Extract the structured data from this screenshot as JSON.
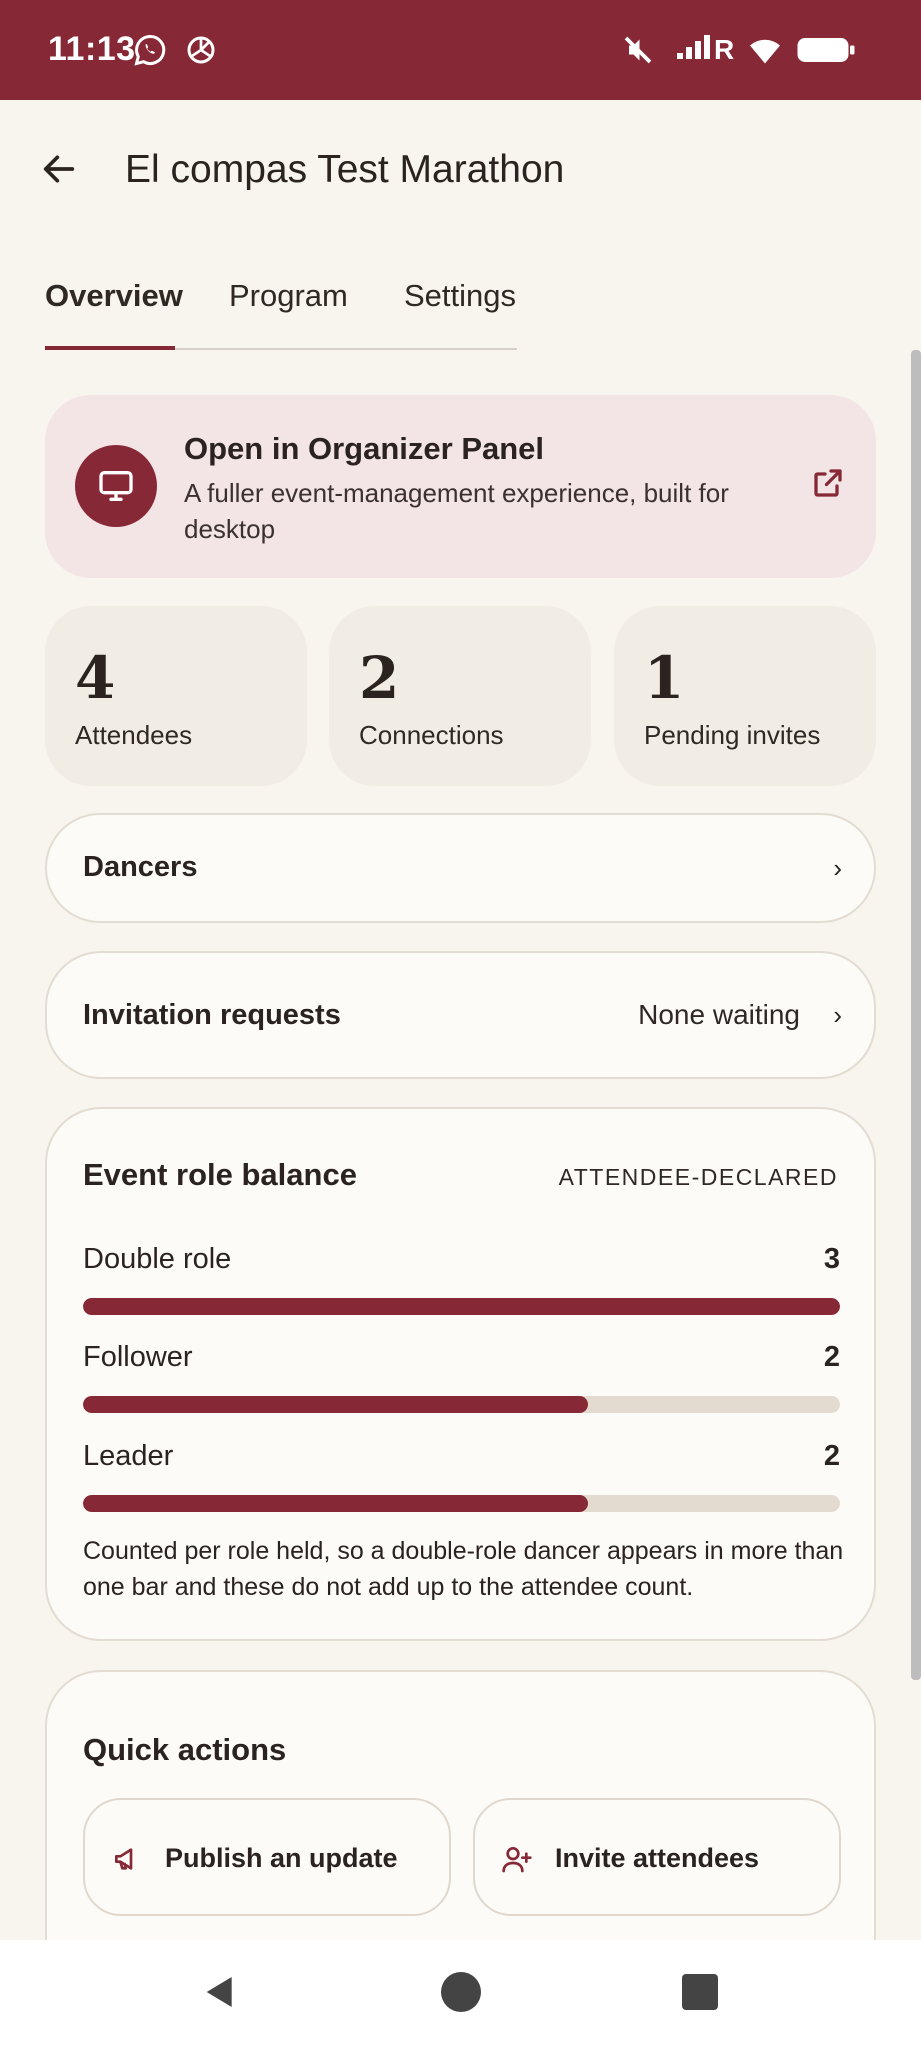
{
  "status_bar": {
    "time": "11:13",
    "network_label": "R",
    "bg_color": "#862835"
  },
  "header": {
    "title": "El compas Test Marathon",
    "back_icon": "arrow-left-icon"
  },
  "tabs": [
    {
      "label": "Overview",
      "active": true
    },
    {
      "label": "Program",
      "active": false
    },
    {
      "label": "Settings",
      "active": false
    }
  ],
  "organizer_panel": {
    "title": "Open in Organizer Panel",
    "description": "A fuller event-management experience, built for desktop",
    "icon": "monitor-icon",
    "action_icon": "external-link-icon"
  },
  "stats": [
    {
      "value": "4",
      "label": "Attendees"
    },
    {
      "value": "2",
      "label": "Connections"
    },
    {
      "value": "1",
      "label": "Pending invites"
    }
  ],
  "rows": {
    "dancers": {
      "label": "Dancers"
    },
    "invitation_requests": {
      "label": "Invitation requests",
      "status": "None waiting"
    }
  },
  "role_balance": {
    "title": "Event role balance",
    "meta": "ATTENDEE-DECLARED",
    "roles": [
      {
        "label": "Double role",
        "count": "3",
        "fill_fraction": 1.0
      },
      {
        "label": "Follower",
        "count": "2",
        "fill_fraction": 0.667
      },
      {
        "label": "Leader",
        "count": "2",
        "fill_fraction": 0.667
      }
    ],
    "note": "Counted per role held, so a double-role dancer appears in more than one bar and these do not add up to the attendee count."
  },
  "quick_actions": {
    "title": "Quick actions",
    "buttons": [
      {
        "label": "Publish an update",
        "icon": "megaphone-icon"
      },
      {
        "label": "Invite attendees",
        "icon": "add-person-icon"
      }
    ]
  },
  "colors": {
    "accent": "#862835",
    "background": "#f8f4ee",
    "organizer_card": "#f3e4e6",
    "stat_card": "#f2ede4",
    "bar_track": "#e4dbd0"
  }
}
